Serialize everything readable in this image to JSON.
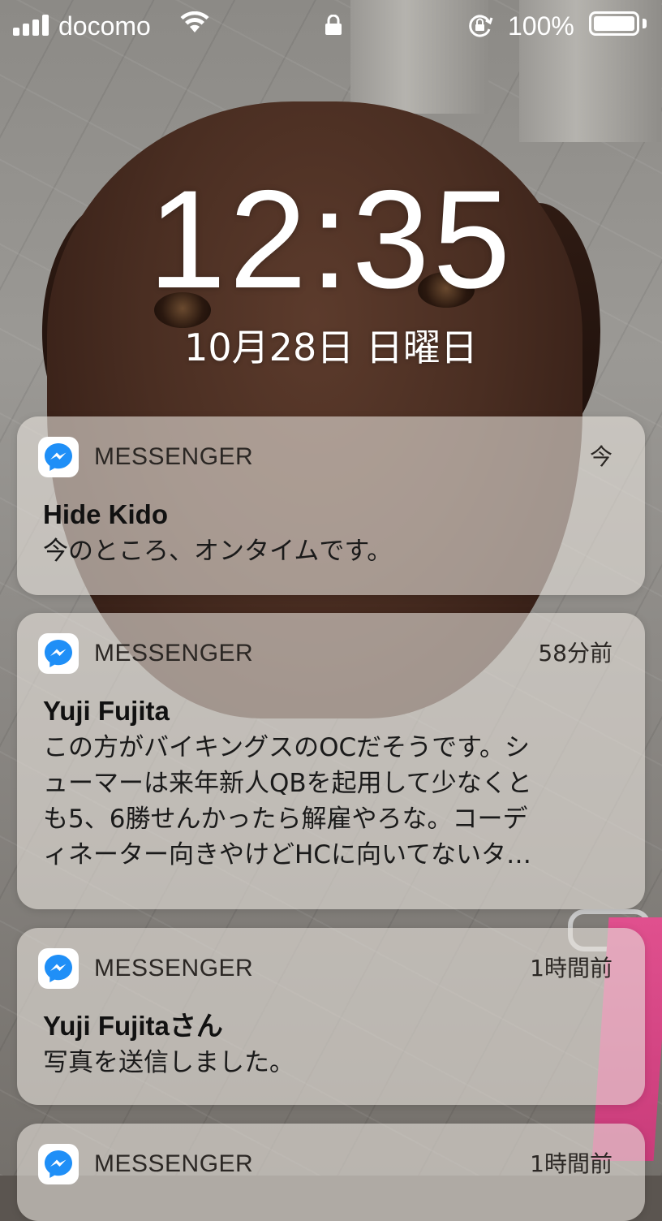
{
  "status_bar": {
    "carrier": "docomo",
    "battery_percent": "100%",
    "battery_level": 1.0,
    "icons": [
      "signal-icon",
      "wifi-icon",
      "lock-icon",
      "rotation-lock-icon",
      "battery-icon"
    ]
  },
  "lock_screen": {
    "time": "12:35",
    "date": "10月28日 日曜日"
  },
  "notifications": [
    {
      "app": "MESSENGER",
      "time": "今",
      "title": "Hide Kido",
      "body": "今のところ、オンタイムです。"
    },
    {
      "app": "MESSENGER",
      "time": "58分前",
      "title": "Yuji Fujita",
      "body": "この方がバイキングスのOCだそうです。シ\nューマーは来年新人QBを起用して少なくと\nも5、6勝せんかったら解雇やろな。コーデ\nィネーター向きやけどHCに向いてないタ…"
    },
    {
      "app": "MESSENGER",
      "time": "1時間前",
      "title": "Yuji Fujitaさん",
      "body": "写真を送信しました。"
    },
    {
      "app": "MESSENGER",
      "time": "1時間前"
    }
  ],
  "colors": {
    "messenger_blue": "#1f8ff7",
    "notification_bg": "rgba(232,226,220,0.60)"
  }
}
